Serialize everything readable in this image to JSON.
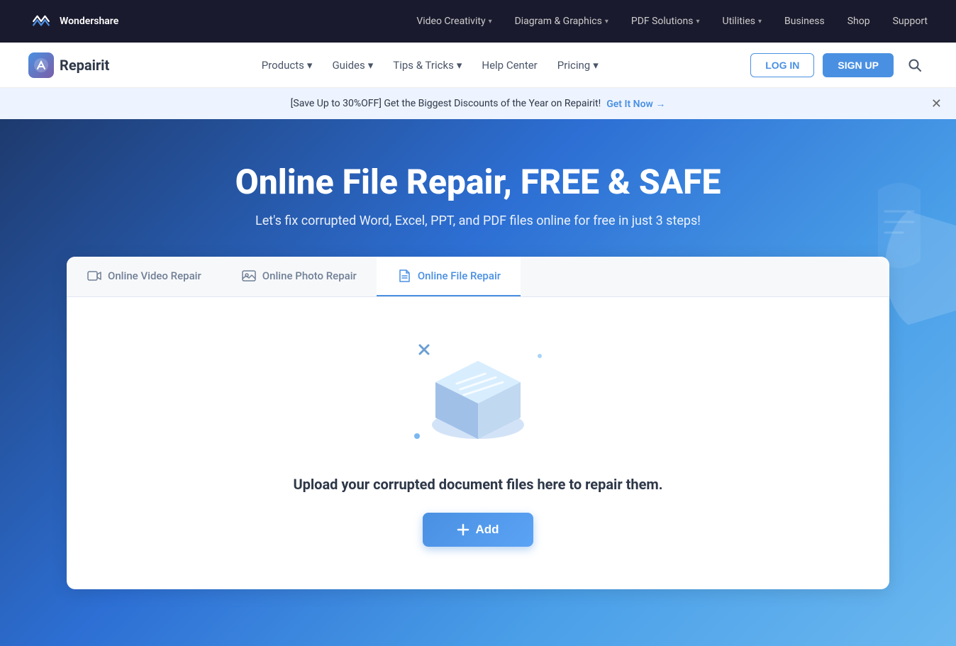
{
  "topNav": {
    "logo": {
      "text": "Wondershare"
    },
    "links": [
      {
        "label": "Video Creativity",
        "hasDropdown": true
      },
      {
        "label": "Diagram & Graphics",
        "hasDropdown": true
      },
      {
        "label": "PDF Solutions",
        "hasDropdown": true
      },
      {
        "label": "Utilities",
        "hasDropdown": true
      },
      {
        "label": "Business"
      },
      {
        "label": "Shop"
      },
      {
        "label": "Support"
      }
    ]
  },
  "subNav": {
    "logoText": "Repairit",
    "links": [
      {
        "label": "Products",
        "hasDropdown": true
      },
      {
        "label": "Guides",
        "hasDropdown": true
      },
      {
        "label": "Tips & Tricks",
        "hasDropdown": true
      },
      {
        "label": "Help Center"
      },
      {
        "label": "Pricing",
        "hasDropdown": true
      }
    ],
    "loginLabel": "LOG IN",
    "signupLabel": "SIGN UP"
  },
  "banner": {
    "text": "[Save Up to 30%OFF] Get the Biggest Discounts of the Year on Repairit!",
    "linkText": "Get It Now →"
  },
  "hero": {
    "title": "Online File Repair, FREE & SAFE",
    "subtitle": "Let's fix corrupted Word, Excel, PPT, and PDF files online for free in just 3 steps!"
  },
  "repairCard": {
    "tabs": [
      {
        "label": "Online Video Repair",
        "icon": "video",
        "active": false
      },
      {
        "label": "Online Photo Repair",
        "icon": "photo",
        "active": false
      },
      {
        "label": "Online File Repair",
        "icon": "file",
        "active": true
      }
    ],
    "uploadText": "Upload your corrupted document files here to repair them.",
    "addButtonLabel": "Add"
  }
}
